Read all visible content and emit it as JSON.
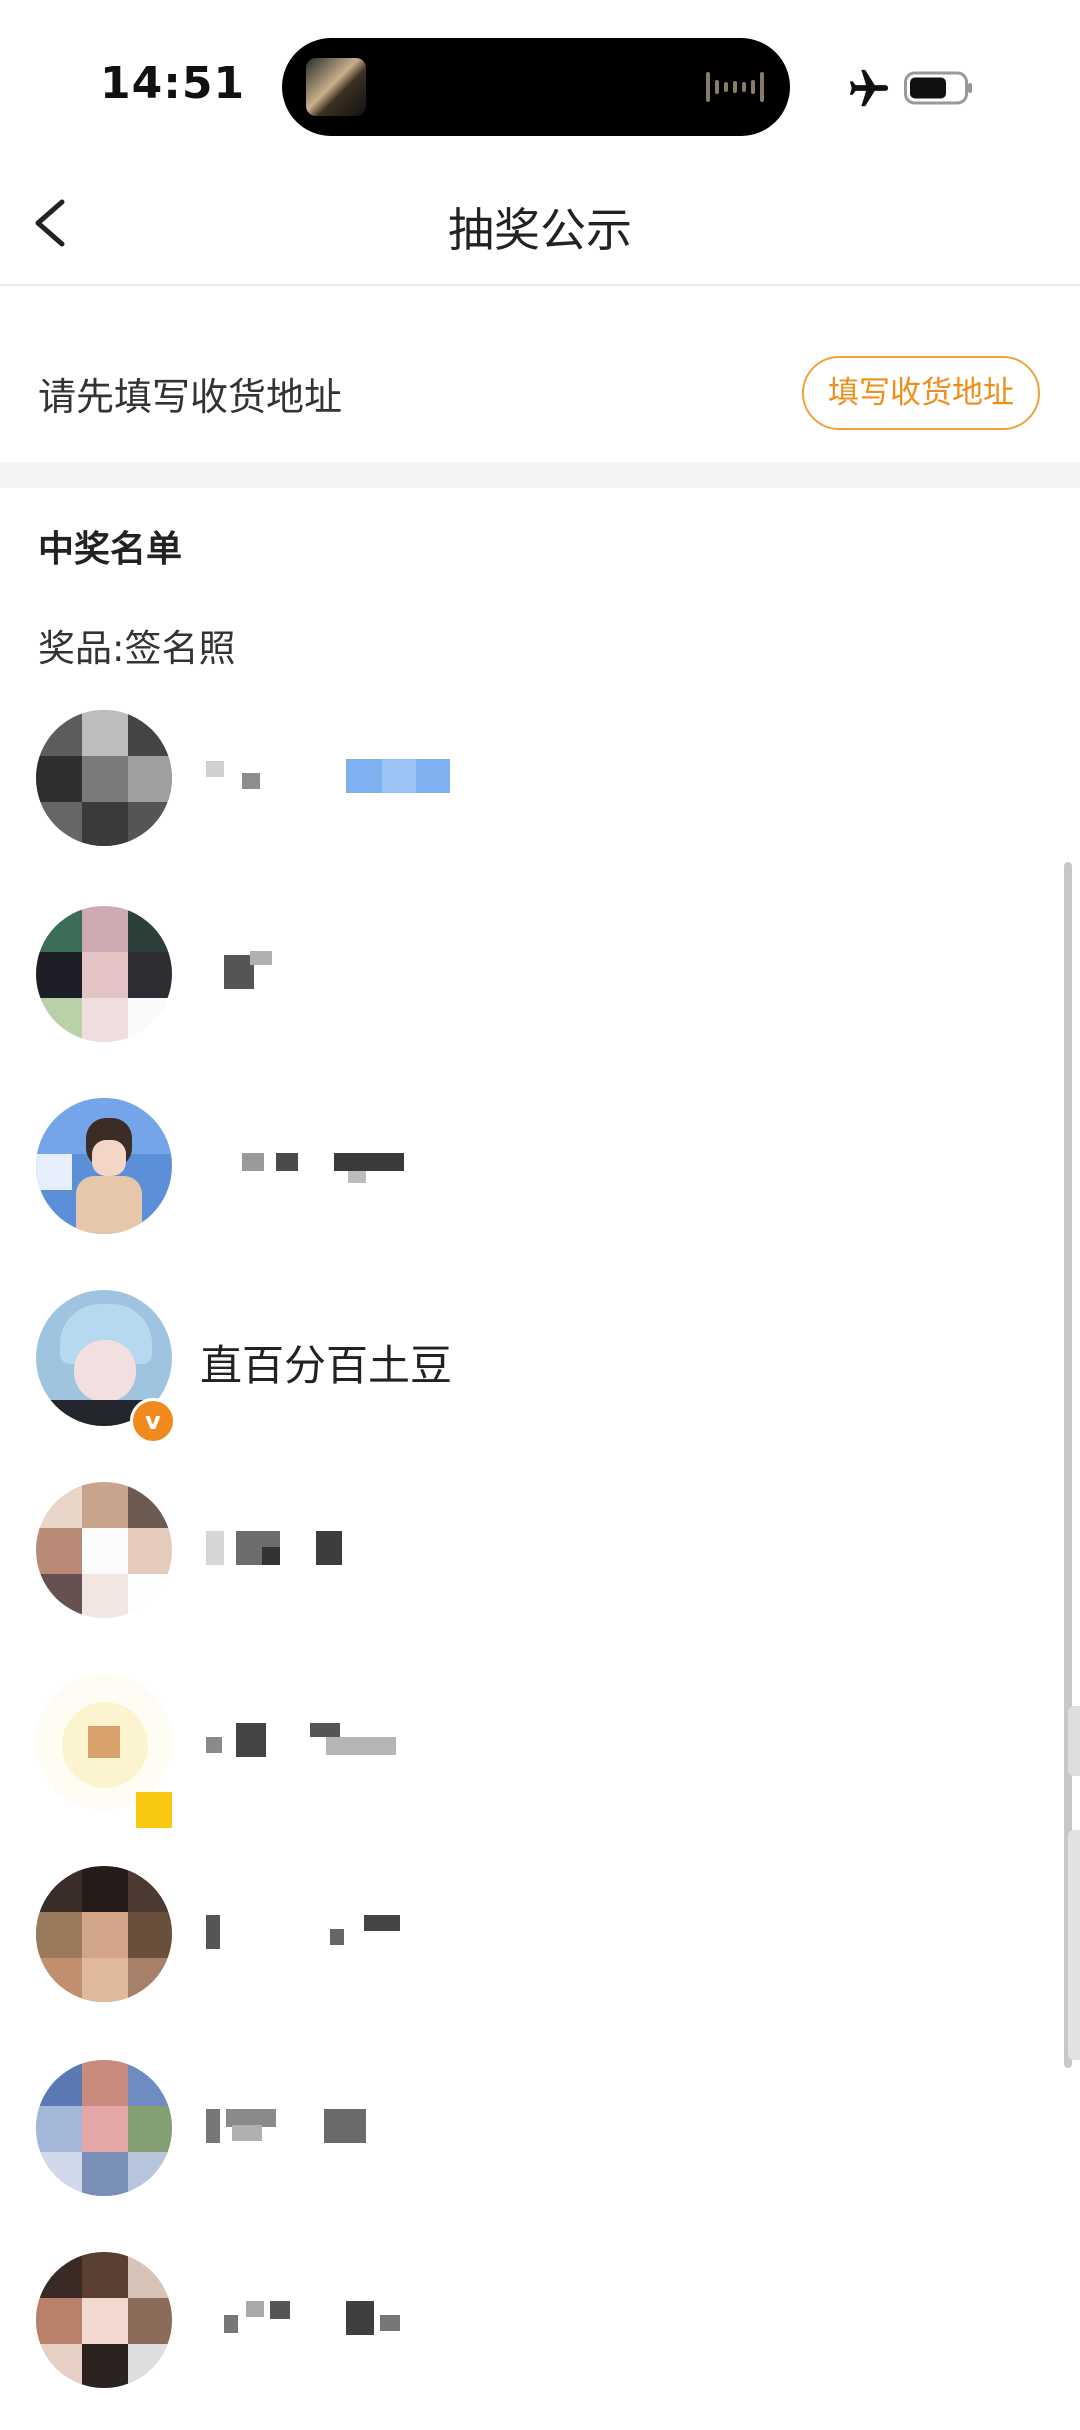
{
  "status_bar": {
    "time": "14:51",
    "airplane_icon": "airplane-icon",
    "battery_icon": "battery-icon"
  },
  "nav": {
    "title": "抽奖公示",
    "back_icon": "chevron-left-icon"
  },
  "address": {
    "tip": "请先填写收货地址",
    "button_label": "填写收货地址",
    "accent_color": "#ef8f1b"
  },
  "winners": {
    "heading": "中奖名单",
    "prize": "奖品:签名照",
    "list": [
      {
        "name_visible": false
      },
      {
        "name_visible": false
      },
      {
        "name_visible": false
      },
      {
        "name_visible": true,
        "name": "直百分百土豆",
        "verified": true
      },
      {
        "name_visible": false
      },
      {
        "name_visible": false
      },
      {
        "name_visible": false
      },
      {
        "name_visible": false
      },
      {
        "name_visible": false
      }
    ]
  }
}
